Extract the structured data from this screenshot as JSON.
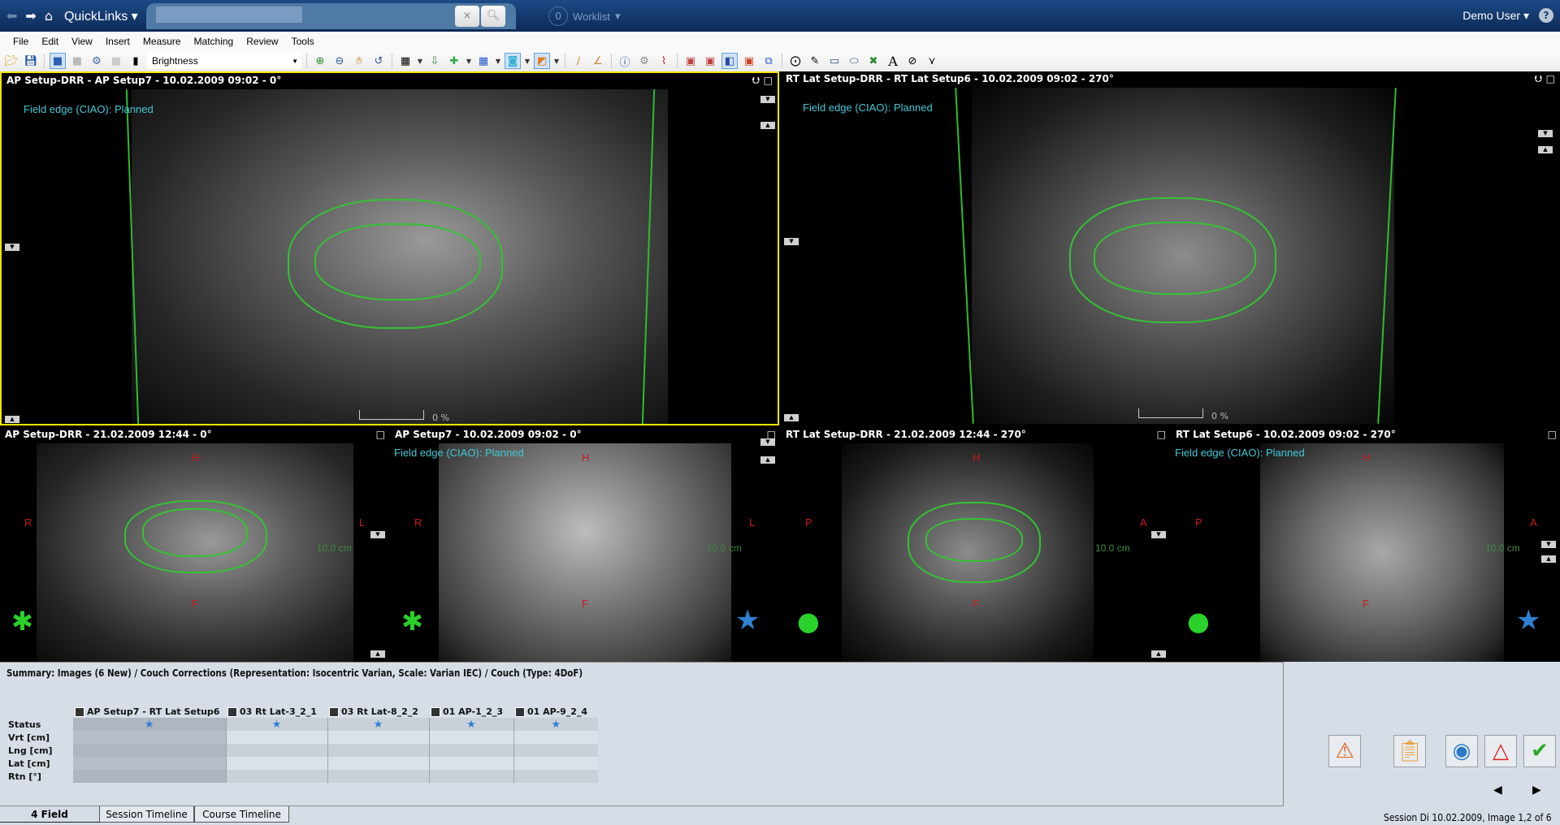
{
  "header": {
    "quicklinks_label": "QuickLinks",
    "search_value": "",
    "clear_label": "×",
    "worklist_count": "0",
    "worklist_label": "Worklist",
    "user_label": "Demo User",
    "help_label": "?"
  },
  "menu": [
    "File",
    "Edit",
    "View",
    "Insert",
    "Measure",
    "Matching",
    "Review",
    "Tools"
  ],
  "toolbar": {
    "window_level_select": "Brightness"
  },
  "panes": {
    "top_left": {
      "title": "AP Setup-DRR - AP Setup7 - 10.02.2009 09:02 - 0°",
      "field_label": "Field edge (CIAO): Planned",
      "blend_percent": "0 %"
    },
    "top_right": {
      "title": "RT Lat Setup-DRR - RT Lat Setup6 - 10.02.2009 09:02 - 270°",
      "field_label": "Field edge (CIAO): Planned",
      "blend_percent": "0 %"
    },
    "bottom_1": {
      "title": "AP Setup-DRR - 21.02.2009 12:44 - 0°",
      "orient_top": "H",
      "orient_left": "R",
      "orient_right": "L",
      "orient_bottom": "F",
      "scale": "10.0 cm"
    },
    "bottom_2": {
      "title": "AP Setup7 - 10.02.2009 09:02 - 0°",
      "field_label": "Field edge (CIAO): Planned",
      "orient_top": "H",
      "orient_left": "R",
      "orient_right": "L",
      "orient_bottom": "F",
      "scale": "10.0 cm"
    },
    "bottom_3": {
      "title": "RT Lat Setup-DRR - 21.02.2009 12:44 - 270°",
      "orient_top": "H",
      "orient_left": "P",
      "orient_right": "A",
      "orient_bottom": "F",
      "scale": "10.0 cm"
    },
    "bottom_4": {
      "title": "RT Lat Setup6 - 10.02.2009 09:02 - 270°",
      "field_label": "Field edge (CIAO): Planned",
      "orient_top": "H",
      "orient_left": "P",
      "orient_right": "A",
      "orient_bottom": "F",
      "scale": "10.0 cm"
    }
  },
  "summary": {
    "title": "Summary: Images (6 New) / Couch Corrections (Representation: Isocentric Varian, Scale: Varian IEC) / Couch (Type: 4DoF)",
    "columns": [
      "AP Setup7 - RT Lat Setup6",
      "03 Rt Lat-3_2_1",
      "03 Rt Lat-8_2_2",
      "01 AP-1_2_3",
      "01 AP-9_2_4"
    ],
    "rows": [
      {
        "label": "Status",
        "values": [
          "★",
          "★",
          "★",
          "★",
          "★"
        ]
      },
      {
        "label": "Vrt [cm]",
        "values": [
          "",
          "",
          "",
          "",
          ""
        ]
      },
      {
        "label": "Lng [cm]",
        "values": [
          "",
          "",
          "",
          "",
          ""
        ]
      },
      {
        "label": "Lat [cm]",
        "values": [
          "",
          "",
          "",
          "",
          ""
        ]
      },
      {
        "label": "Rtn [°]",
        "values": [
          "",
          "",
          "",
          "",
          ""
        ]
      }
    ]
  },
  "tabs": [
    "4 Field",
    "Session Timeline",
    "Course Timeline"
  ],
  "status_text": "Session Di 10.02.2009, Image 1,2 of 6",
  "colors": {
    "field_label": "#44c8d6",
    "contour": "#33c333",
    "orientation": "#cc1a1a",
    "selection": "#f2e500",
    "approved_star": "#2f7fd2"
  }
}
